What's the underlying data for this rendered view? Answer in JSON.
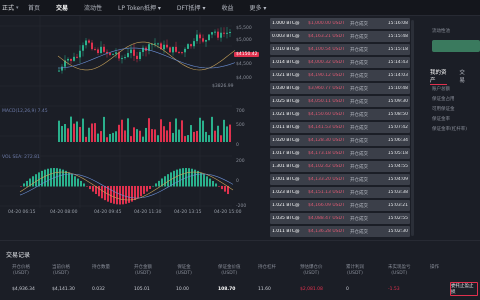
{
  "brand": {
    "label": "正式",
    "caret": "▾"
  },
  "nav": [
    {
      "label": "首页",
      "active": false
    },
    {
      "label": "交易",
      "active": true
    },
    {
      "label": "流动性",
      "active": false
    },
    {
      "label": "LP Token抵押 ▾",
      "active": false
    },
    {
      "label": "DFT抵押 ▾",
      "active": false
    },
    {
      "label": "收益",
      "active": false
    },
    {
      "label": "更多 ▾",
      "active": false
    }
  ],
  "chart": {
    "price_labels": [
      "$5,500",
      "$5,000",
      "$4,500",
      "$4,000"
    ],
    "price_tag": "$4150.42",
    "low_label": "$3826.99",
    "ind1": "MACD(12,26,9)  7.45",
    "ind2": "VOL  SEA: 272.81",
    "ind1_scale": [
      "700",
      "500",
      "0"
    ],
    "ind2_scale": [
      "200",
      "0",
      "-200"
    ],
    "times": [
      "04-20 06:15",
      "04-20 08:00",
      "04-20 09:45",
      "04-20 11:30",
      "04-20 13:15",
      "04-20 15:00"
    ],
    "colors": {
      "up": "#2ab08c",
      "down": "#e0314e"
    }
  },
  "trades": [
    {
      "amount": "1.000 BTC@",
      "value": "$1,000.00 USDT",
      "status": "开仓成交",
      "time": "15:16:08"
    },
    {
      "amount": "0.003 BTC@",
      "value": "$4,163.21 USDT",
      "status": "开仓成交",
      "time": "15:15:48"
    },
    {
      "amount": "1.010 BTC@",
      "value": "$4,100.54 USDT",
      "status": "开仓成交",
      "time": "15:15:18"
    },
    {
      "amount": "1.014 BTC@",
      "value": "$4,000.32 USDT",
      "status": "开仓成交",
      "time": "15:14:43"
    },
    {
      "amount": "1.021 BTC@",
      "value": "$4,190.12 USDT",
      "status": "开仓成交",
      "time": "15:14:03"
    },
    {
      "amount": "1.030 BTC@",
      "value": "$3,960.77 USDT",
      "status": "开仓成交",
      "time": "15:10:48"
    },
    {
      "amount": "1.025 BTC@",
      "value": "$4,050.11 USDT",
      "status": "开仓成交",
      "time": "15:09:30"
    },
    {
      "amount": "1.021 BTC@",
      "value": "$4,150.60 USDT",
      "status": "开仓成交",
      "time": "15:08:50"
    },
    {
      "amount": "1.011 BTC@",
      "value": "$4,141.53 USDT",
      "status": "开仓成交",
      "time": "15:07:42"
    },
    {
      "amount": "1.020 BTC@",
      "value": "$4,128.30 USDT",
      "status": "开仓成交",
      "time": "15:06:34"
    },
    {
      "amount": "1.017 BTC@",
      "value": "$4,173.18 USDT",
      "status": "开仓成交",
      "time": "15:05:18"
    },
    {
      "amount": "1.301 BTC@",
      "value": "$4,102.42 USDT",
      "status": "开仓成交",
      "time": "15:04:55"
    },
    {
      "amount": "1.001 BTC@",
      "value": "$4,133.20 USDT",
      "status": "开仓成交",
      "time": "15:04:09"
    },
    {
      "amount": "1.023 BTC@",
      "value": "$4,151.13 USDT",
      "status": "开仓成交",
      "time": "15:03:38"
    },
    {
      "amount": "1.021 BTC@",
      "value": "$4,166.09 USDT",
      "status": "开仓成交",
      "time": "15:03:21"
    },
    {
      "amount": "1.035 BTC@",
      "value": "$4,088.47 USDT",
      "status": "开仓成交",
      "time": "15:02:55"
    },
    {
      "amount": "1.011 BTC@",
      "value": "$4,136.28 USDT",
      "status": "开仓成交",
      "time": "15:02:30"
    }
  ],
  "right_panel": {
    "tabs": [
      {
        "label": "我的资产",
        "active": true
      },
      {
        "label": "交易",
        "active": false
      }
    ],
    "top_label": "流动性池",
    "lines": [
      "账户总额",
      "保证金占用",
      "可用保证金",
      "保证金率",
      "保证金率(杠杆率)"
    ]
  },
  "history": {
    "title": "交易记录",
    "columns": [
      {
        "h": "开仓价格\n(USDT)",
        "v": "$4,936.34",
        "cls": ""
      },
      {
        "h": "当前价格\n(USDT)",
        "v": "$4,141.30",
        "cls": ""
      },
      {
        "h": "持仓数量",
        "v": "0.032",
        "cls": ""
      },
      {
        "h": "开仓金额\n(USDT)",
        "v": "105.01",
        "cls": ""
      },
      {
        "h": "保证金\n(USDT)",
        "v": "10.00",
        "cls": ""
      },
      {
        "h": "保证金价值\n(USDT)",
        "v": "108.70",
        "cls": "bold"
      },
      {
        "h": "持仓杠杆",
        "v": "11.60",
        "cls": ""
      },
      {
        "h": "预估爆仓价\n(USDT)",
        "v": "$2,081.08",
        "cls": "neg"
      },
      {
        "h": "累计利润\n(USDT)",
        "v": "0",
        "cls": ""
      },
      {
        "h": "未实现盈亏\n(USDT)",
        "v": "-1.53",
        "cls": "neg"
      },
      {
        "h": "操作",
        "v": "",
        "cls": ""
      }
    ],
    "action_button": "委托止盈止损"
  }
}
